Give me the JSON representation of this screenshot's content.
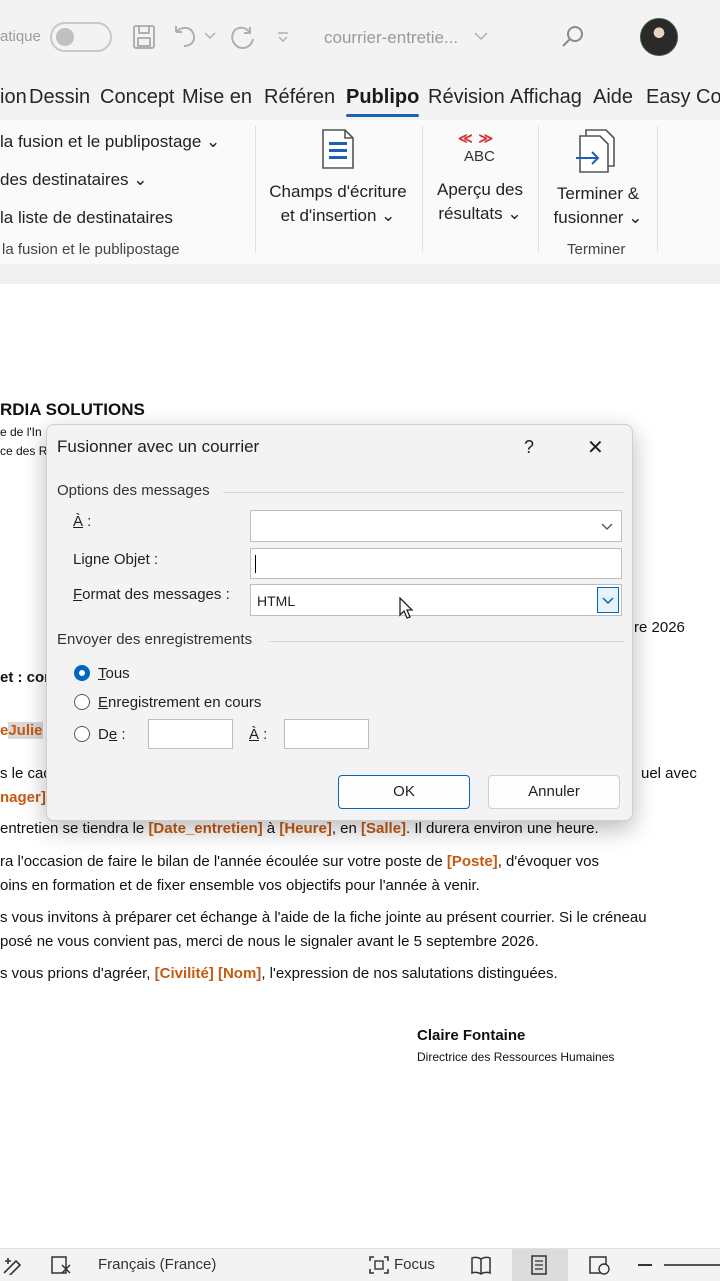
{
  "titlebar": {
    "autosave_label": "atique",
    "document_title": "courrier-entretie..."
  },
  "tabs": [
    "ion",
    "Dessin",
    "Concept",
    "Mise en",
    "Référen",
    "Publipo",
    "Révision",
    "Affichag",
    "Aide",
    "Easy Co"
  ],
  "ribbon": {
    "start_merge": "la fusion et le publipostage",
    "select_recipients": "des destinataires",
    "edit_recipient_list": "la liste de destinataires",
    "group_start": "la fusion et le publipostage",
    "write_insert_line1": "Champs d'écriture",
    "write_insert_line2": "et d'insertion",
    "abc_label": "ABC",
    "preview_line1": "Aperçu des",
    "preview_line2": "résultats",
    "finish_line1": "Terminer &",
    "finish_line2": "fusionner",
    "group_finish": "Terminer"
  },
  "document": {
    "company": "RDIA SOLUTIONS",
    "addr1": "e de l'In",
    "addr2": "ce des R",
    "date_fragment": "re 2026",
    "subject": "et : con",
    "salutation_field": "Julie",
    "salutation_prefix": "e",
    "p1_a": "s le cad",
    "p1_b": "uel avec",
    "p1_field": "nager]",
    "p2_a": "entretien se tiendra le ",
    "p2_f1": "[Date_entretien]",
    "p2_b": " à ",
    "p2_f2": "[Heure]",
    "p2_c": ", en ",
    "p2_f3": "[Salle]",
    "p2_d": ". Il durera environ une heure.",
    "p3_a": "ra l'occasion de faire le bilan de l'année écoulée sur votre poste de ",
    "p3_f1": "[Poste]",
    "p3_b": ", d'évoquer vos",
    "p3_line2": "oins en formation et de fixer ensemble vos objectifs pour l'année à venir.",
    "p4_line1": "s vous invitons à préparer cet échange à l'aide de la fiche jointe au présent courrier. Si le créneau",
    "p4_line2": "posé ne vous convient pas, merci de nous le signaler avant le 5 septembre 2026.",
    "p5_a": "s vous prions d'agréer, ",
    "p5_f1": "[Civilité]",
    "p5_sp": " ",
    "p5_f2": "[Nom]",
    "p5_b": ", l'expression de nos salutations distinguées.",
    "signer_name": "Claire Fontaine",
    "signer_title": "Directrice des Ressources Humaines"
  },
  "dialog": {
    "title": "Fusionner avec un courrier",
    "help": "?",
    "close": "✕",
    "section_options": "Options des messages",
    "to_label": "À :",
    "to_value": "",
    "subject_label": "Ligne Objet :",
    "subject_value": "",
    "format_label": "Format des messages :",
    "format_value": "HTML",
    "section_send": "Envoyer des enregistrements",
    "radio_all": "Tous",
    "radio_current": "Enregistrement en cours",
    "radio_from": "De :",
    "to2_label": "À :",
    "from_value": "",
    "to2_value": "",
    "ok": "OK",
    "cancel": "Annuler"
  },
  "statusbar": {
    "language": "Français (France)",
    "focus": "Focus"
  }
}
